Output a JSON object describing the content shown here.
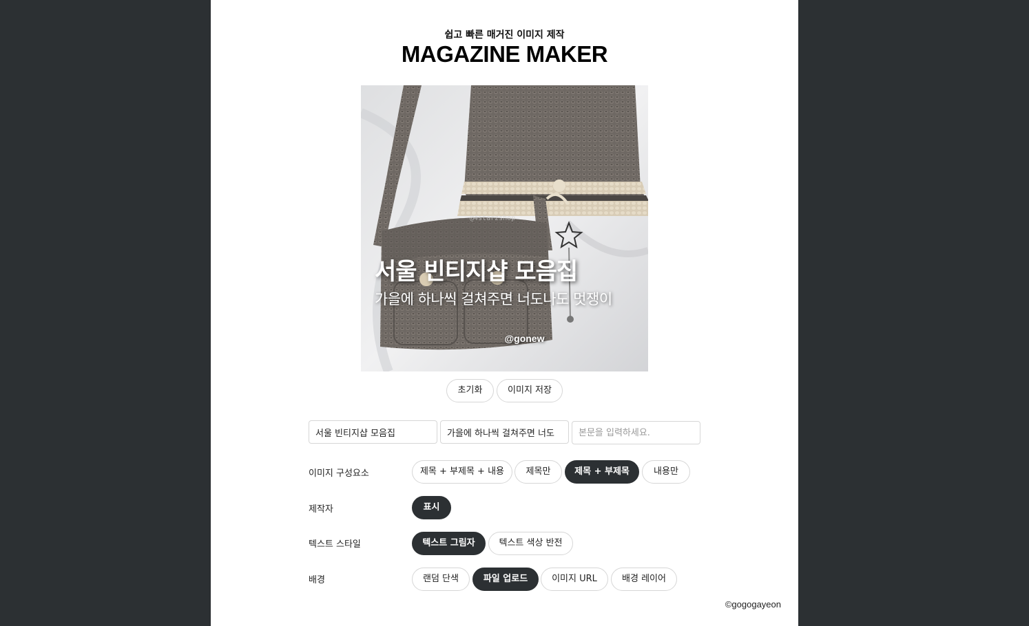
{
  "header": {
    "subtitle": "쉽고 빠른 매거진 이미지 제작",
    "title": "MAGAZINE MAKER"
  },
  "preview": {
    "title": "서울 빈티지샵 모음집",
    "subtitle": "가을에 하나씩 걸쳐주면 너도나도 멋쟁이",
    "author": "@gonew",
    "watermark": "@4starzshop"
  },
  "actions": {
    "reset_label": "초기화",
    "save_label": "이미지 저장"
  },
  "inputs": {
    "title_value": "서울 빈티지샵 모음집",
    "subtitle_value": "가을에 하나씩 걸쳐주면 너도",
    "body_placeholder": "본문을 입력하세요."
  },
  "options": {
    "composition": {
      "label": "이미지 구성요소",
      "items": [
        "제목 + 부제목 + 내용",
        "제목만",
        "제목 + 부제목",
        "내용만"
      ],
      "selected": "제목 + 부제목"
    },
    "author": {
      "label": "제작자",
      "items": [
        "표시"
      ],
      "selected": "표시"
    },
    "text_style": {
      "label": "텍스트 스타일",
      "items": [
        "텍스트 그림자",
        "텍스트 색상 반전"
      ],
      "selected": "텍스트 그림자"
    },
    "background": {
      "label": "배경",
      "items": [
        "랜덤 단색",
        "파일 업로드",
        "이미지 URL",
        "배경 레이어"
      ],
      "selected": "파일 업로드"
    }
  },
  "footer": {
    "copyright": "©gogogayeon"
  },
  "colors": {
    "page_background": "#2c3033",
    "panel": "#ffffff",
    "active_pill": "#2c3033"
  }
}
